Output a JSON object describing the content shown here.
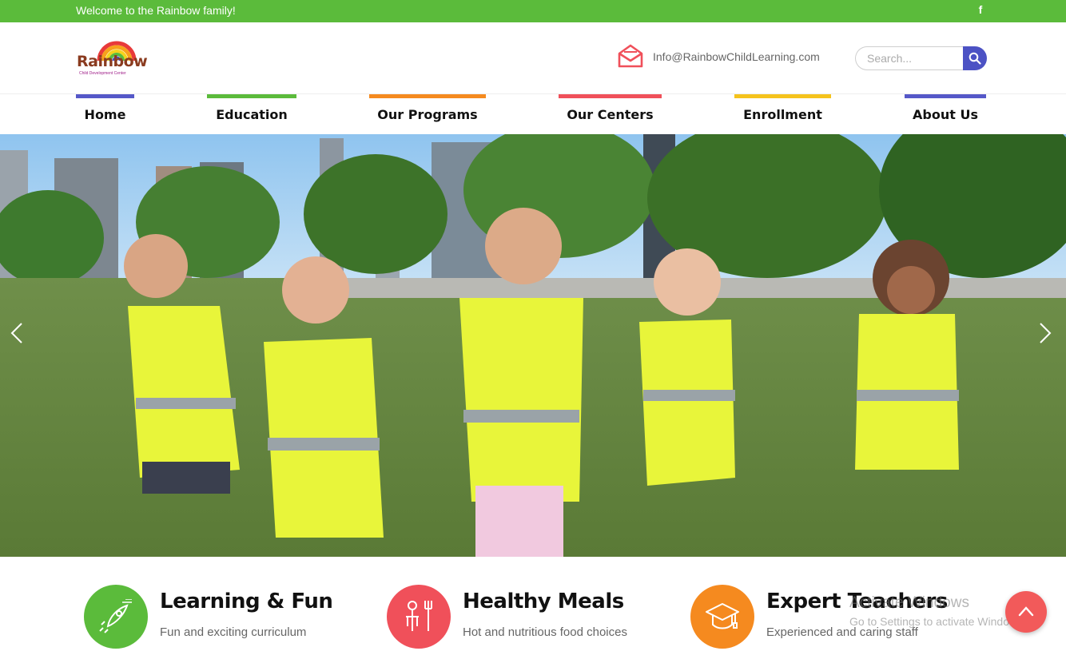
{
  "topbar": {
    "welcome": "Welcome to the Rainbow family!",
    "social_icon": "facebook-icon",
    "social_glyph": "f"
  },
  "header": {
    "logo": {
      "word": "Rainbow",
      "tagline": "Child Development Center"
    },
    "email": {
      "icon": "envelope-icon",
      "text": "Info@RainbowChildLearning.com"
    },
    "search": {
      "placeholder": "Search...",
      "icon": "search-icon"
    }
  },
  "nav": {
    "items": [
      {
        "label": "Home",
        "color": "#5558c8"
      },
      {
        "label": "Education",
        "color": "#5bbb3b"
      },
      {
        "label": "Our Programs",
        "color": "#f58a1f"
      },
      {
        "label": "Our Centers",
        "color": "#f0505a"
      },
      {
        "label": "Enrollment",
        "color": "#f5c31c"
      },
      {
        "label": "About Us",
        "color": "#5558c8"
      }
    ]
  },
  "hero": {
    "prev_icon": "chevron-left-icon",
    "next_icon": "chevron-right-icon"
  },
  "features": [
    {
      "title": "Learning & Fun",
      "desc": "Fun and exciting curriculum",
      "color": "#5bbb3b",
      "icon": "rocket-icon"
    },
    {
      "title": "Healthy Meals",
      "desc": "Hot and nutritious food choices",
      "color": "#f0505a",
      "icon": "dining-icon"
    },
    {
      "title": "Expert Teachers",
      "desc": "Experienced and caring staff",
      "color": "#f58a1f",
      "icon": "graduation-cap-icon"
    }
  ],
  "watermark": {
    "line1": "Activate Windows",
    "line2": "Go to Settings to activate Windows."
  },
  "scroll_top": {
    "icon": "chevron-up-icon",
    "color": "#f25a5a"
  }
}
